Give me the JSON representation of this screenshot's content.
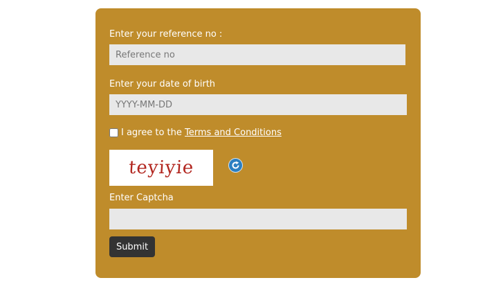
{
  "form": {
    "reference": {
      "label": "Enter your reference no :",
      "placeholder": "Reference no",
      "value": ""
    },
    "dob": {
      "label": "Enter your date of birth",
      "placeholder": "YYYY-MM-DD",
      "value": ""
    },
    "terms": {
      "prefix": "I agree to the ",
      "link_text": "Terms and Conditions",
      "checked": false
    },
    "captcha": {
      "image_text": "teyiyie",
      "refresh_icon": "refresh-icon",
      "label": "Enter Captcha",
      "value": ""
    },
    "submit_label": "Submit"
  },
  "colors": {
    "card_background": "#bf8c2b",
    "input_background": "#e8e8e8",
    "button_background": "#333333",
    "captcha_text": "#b2261f",
    "refresh_icon": "#2b7fc1"
  }
}
